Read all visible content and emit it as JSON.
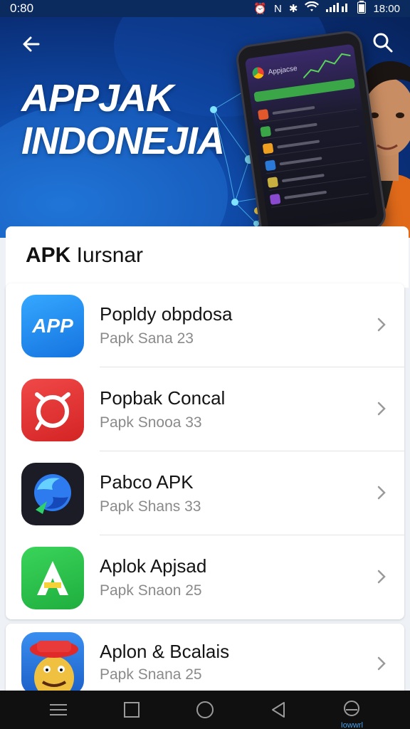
{
  "status_bar": {
    "left_time": "0:80",
    "right_time": "18:00"
  },
  "hero": {
    "title_line1": "APPJAK",
    "title_line2": "INDONEJIA",
    "phone_app_label": "Appjacse"
  },
  "section": {
    "title_bold": "APK",
    "title_rest": " Iursnar"
  },
  "apps": [
    {
      "name": "Popldy obpdosa",
      "sub": "Papk Sana 23",
      "icon": "app-store-blue-icon",
      "icon_text": "APP",
      "color": "#1e8ff0"
    },
    {
      "name": "Popbak Concal",
      "sub": "Papk Snooa 33",
      "icon": "red-target-icon",
      "color": "#e53935"
    },
    {
      "name": "Pabco APK",
      "sub": "Papk Shans 33",
      "icon": "swirl-dark-icon",
      "color": "#1a1a24"
    },
    {
      "name": "Aplok Apjsad",
      "sub": "Papk Snaon 25",
      "icon": "green-a-icon",
      "icon_text": "A",
      "color": "#2cc04a"
    },
    {
      "name": "Aplon & Bcalais",
      "sub": "Papk Snana 25",
      "icon": "cartoon-hat-icon",
      "color": "#2a78d8"
    }
  ],
  "nav": {
    "home_label": "Iowwrl"
  }
}
